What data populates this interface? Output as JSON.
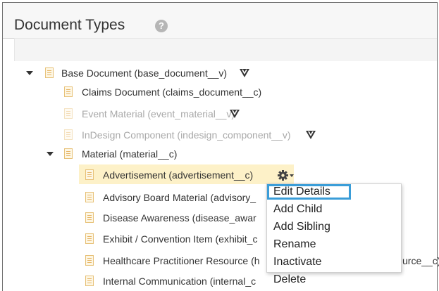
{
  "header": {
    "title": "Document Types",
    "help_icon": "?"
  },
  "tree": {
    "nodes": [
      {
        "label": "Base Document (base_document__v)",
        "icon": "document-icon",
        "expanded": true,
        "filter_icon": true,
        "faded": false
      },
      {
        "label": "Claims Document (claims_document__c)",
        "icon": "document-icon",
        "faded": false
      },
      {
        "label": "Event Material (event_material__v)",
        "icon": "document-icon",
        "filter_icon": true,
        "faded": true
      },
      {
        "label": "InDesign Component (indesign_component__v)",
        "icon": "document-icon",
        "filter_icon": true,
        "faded": true
      },
      {
        "label": "Material (material__c)",
        "icon": "document-icon",
        "expanded": true,
        "faded": false
      },
      {
        "label": "Advertisement (advertisement__c)",
        "icon": "document-icon",
        "selected": true,
        "faded": false
      },
      {
        "label": "Advisory Board Material (advisory_",
        "icon": "document-icon",
        "faded": false
      },
      {
        "label": "Disease Awareness (disease_awar",
        "icon": "document-icon",
        "faded": false
      },
      {
        "label": "Exhibit / Convention Item (exhibit_c",
        "icon": "document-icon",
        "faded": false
      },
      {
        "label": "Healthcare Practitioner Resource (h",
        "label_tail": "urce__c)",
        "icon": "document-icon",
        "faded": false
      },
      {
        "label": "Internal Communication (internal_c",
        "icon": "document-icon",
        "faded": false
      }
    ]
  },
  "context_menu": {
    "items": [
      "Edit Details",
      "Add Child",
      "Add Sibling",
      "Rename",
      "Inactivate",
      "Delete"
    ],
    "focused_index": 0
  },
  "colors": {
    "selection": "#fdf1c8",
    "focus_outline": "#3a9dd8",
    "faded_text": "#a9a9a9"
  }
}
